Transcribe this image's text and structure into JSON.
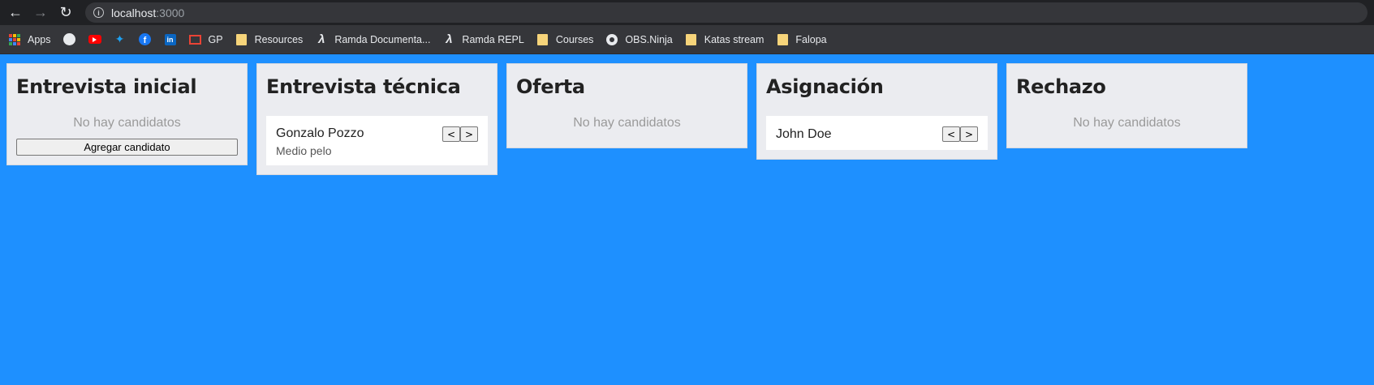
{
  "browser": {
    "url_host": "localhost",
    "url_port": ":3000",
    "info_glyph": "i",
    "bookmarks": [
      {
        "icon": "apps-grid-icon",
        "label": "Apps"
      },
      {
        "icon": "github-icon",
        "label": ""
      },
      {
        "icon": "youtube-icon",
        "label": ""
      },
      {
        "icon": "twitter-icon",
        "label": ""
      },
      {
        "icon": "facebook-icon",
        "label": ""
      },
      {
        "icon": "linkedin-icon",
        "label": ""
      },
      {
        "icon": "gmail-icon",
        "label": "GP"
      },
      {
        "icon": "folder-icon",
        "label": "Resources"
      },
      {
        "icon": "ramda-lambda-icon",
        "label": "Ramda Documenta..."
      },
      {
        "icon": "ramda-lambda-icon",
        "label": "Ramda REPL"
      },
      {
        "icon": "folder-icon",
        "label": "Courses"
      },
      {
        "icon": "obs-ninja-icon",
        "label": "OBS.Ninja"
      },
      {
        "icon": "folder-icon",
        "label": "Katas stream"
      },
      {
        "icon": "folder-icon",
        "label": "Falopa"
      }
    ]
  },
  "board": {
    "columns": [
      {
        "title": "Entrevista inicial",
        "empty_text": "No hay candidatos",
        "add_label": "Agregar candidato"
      },
      {
        "title": "Entrevista técnica",
        "cards": [
          {
            "name": "Gonzalo Pozzo",
            "subtitle": "Medio pelo",
            "prev": "<",
            "next": ">"
          }
        ]
      },
      {
        "title": "Oferta",
        "empty_text": "No hay candidatos"
      },
      {
        "title": "Asignación",
        "cards": [
          {
            "name": "John Doe",
            "prev": "<",
            "next": ">"
          }
        ]
      },
      {
        "title": "Rechazo",
        "empty_text": "No hay candidatos"
      }
    ]
  },
  "colors": {
    "page_background": "#1e90ff",
    "column_background": "#ebecf0",
    "card_background": "#ffffff"
  }
}
